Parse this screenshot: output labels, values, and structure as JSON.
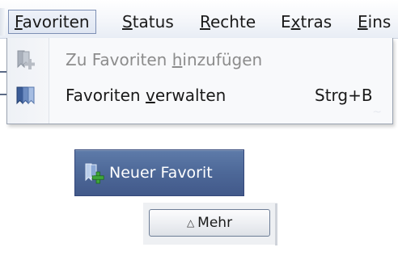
{
  "menubar": {
    "items": [
      {
        "pre": "",
        "acc": "F",
        "post": "avoriten",
        "active": true
      },
      {
        "pre": "",
        "acc": "S",
        "post": "tatus"
      },
      {
        "pre": "",
        "acc": "R",
        "post": "echte"
      },
      {
        "pre": "E",
        "acc": "x",
        "post": "tras"
      },
      {
        "pre": "",
        "acc": "E",
        "post": "ins"
      }
    ]
  },
  "dropdown": {
    "items": [
      {
        "pre": "Zu Favoriten ",
        "acc": "h",
        "post": "inzufügen",
        "shortcut": "",
        "enabled": false,
        "icon": "bookmark-add-icon"
      },
      {
        "pre": "Favoriten ",
        "acc": "v",
        "post": "erwalten",
        "shortcut": "Strg+B",
        "enabled": true,
        "icon": "bookmarks-manage-icon"
      }
    ]
  },
  "new_favorite_button": {
    "label": "Neuer Favorit",
    "icon": "bookmark-add-icon"
  },
  "more_button": {
    "label": "Mehr",
    "icon": "up-triangle-icon"
  },
  "colors": {
    "menubar_bg": "#f4f6fa",
    "active_border": "#7d8fb4",
    "new_fav_bg": "#4d6898",
    "plus_green": "#3fa63a"
  }
}
